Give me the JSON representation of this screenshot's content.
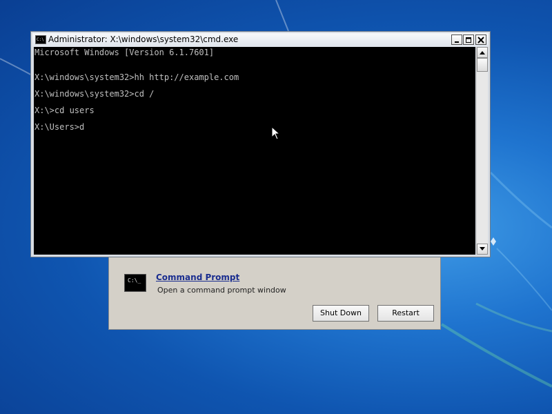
{
  "console": {
    "title": "Administrator: X:\\windows\\system32\\cmd.exe",
    "title_icon_text": "C:\\",
    "lines": [
      "Microsoft Windows [Version 6.1.7601]",
      "X:\\windows\\system32>hh http://example.com",
      "X:\\windows\\system32>cd /",
      "X:\\>cd users",
      "X:\\Users>d"
    ]
  },
  "recovery": {
    "option_title": "Command Prompt",
    "option_description": "Open a command prompt window",
    "option_icon_text": "C:\\_",
    "shutdown_label": "Shut Down",
    "restart_label": "Restart"
  },
  "icons": {
    "console": "cmd-icon",
    "minimize": "minimize-icon",
    "maximize": "maximize-icon",
    "close": "close-icon",
    "cursor": "mouse-pointer-icon"
  },
  "colors": {
    "desktop": "#1f74cf",
    "terminal_bg": "#000000",
    "terminal_fg": "#c0c0c0",
    "link": "#1a2d8f"
  }
}
